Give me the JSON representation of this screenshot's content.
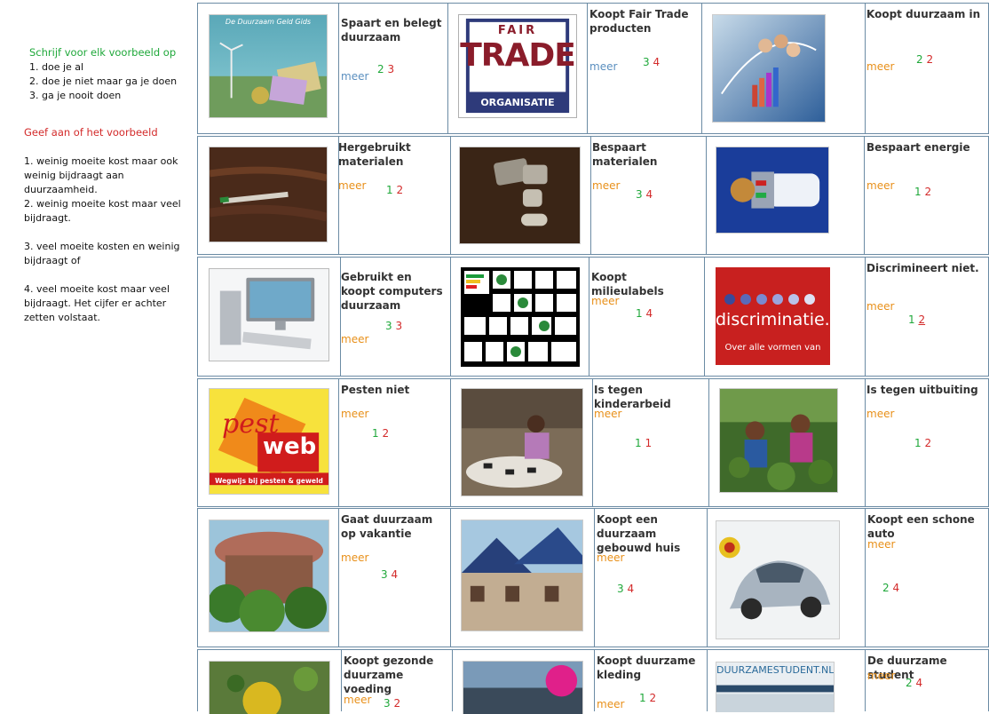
{
  "sidebar": {
    "instruction_green": "Schrijf voor elk voorbeeld op",
    "options": [
      "1. doe je al",
      "2. doe je niet maar ga je doen",
      "3. ga je nooit doen"
    ],
    "instruction_red": "Geef aan of het voorbeeld",
    "para1": "1. weinig moeite kost maar ook weinig bijdraagt aan duurzaamheid.",
    "para2": "2. weinig moeite kost maar veel bijdraagt.",
    "para3": "3. veel moeite kosten en weinig bijdraagt of",
    "para4": "4. veel moeite kost maar veel bijdraagt. Het cijfer er achter zetten volstaat."
  },
  "link_text": "meer",
  "items": [
    {
      "title": "Spaart en belegt duurzaam",
      "s1": "2",
      "s2": "3",
      "image_text": "De Duurzaam Geld Gids"
    },
    {
      "title": "Koopt Fair Trade producten",
      "s1": "3",
      "s2": "4",
      "image_text_1": "FAIR",
      "image_text_2": "TRADE",
      "image_text_3": "ORGANISATIE"
    },
    {
      "title": "Koopt duurzaam in",
      "s1": "2",
      "s2": "2"
    },
    {
      "title": "Hergebruikt materialen",
      "s1": "1",
      "s2": "2"
    },
    {
      "title": "Bespaart materialen",
      "s1": "3",
      "s2": "4"
    },
    {
      "title": "Bespaart energie",
      "s1": "1",
      "s2": "2"
    },
    {
      "title": "Gebruikt en koopt computers duurzaam",
      "s1": "3",
      "s2": "3"
    },
    {
      "title": "Koopt milieulabels",
      "s1": "1",
      "s2": "4"
    },
    {
      "title": "Discrimineert niet.",
      "s1": "1",
      "s2": "2",
      "image_text_1": "discriminatie.nl",
      "image_text_2": "Over alle vormen van"
    },
    {
      "title": "Pesten niet",
      "s1": "1",
      "s2": "2",
      "image_text_1": "pest",
      "image_text_2": "web",
      "image_text_3": "Wegwijs bij pesten & geweld"
    },
    {
      "title": "Is tegen kinderarbeid",
      "s1": "1",
      "s2": "1"
    },
    {
      "title": "Is tegen uitbuiting",
      "s1": "1",
      "s2": "2"
    },
    {
      "title": "Gaat duurzaam op vakantie",
      "s1": "3",
      "s2": "4"
    },
    {
      "title": "Koopt een duurzaam gebouwd huis",
      "s1": "3",
      "s2": "4"
    },
    {
      "title": "Koopt een schone auto",
      "s1": "2",
      "s2": "4"
    },
    {
      "title": "Koopt gezonde duurzame voeding",
      "s1": "3",
      "s2": "2"
    },
    {
      "title": "Koopt duurzame kleding",
      "s1": "1",
      "s2": "2"
    },
    {
      "title": "De duurzame student",
      "s1": "2",
      "s2": "4",
      "image_text_1": "DUURZAMESTUDENT.NL"
    }
  ]
}
